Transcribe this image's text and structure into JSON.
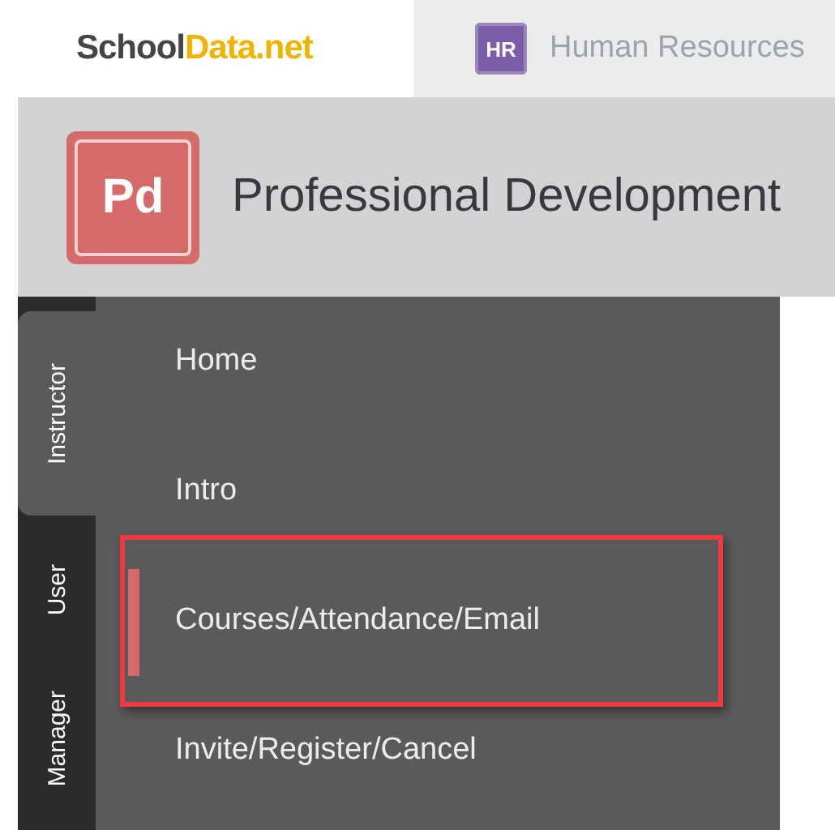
{
  "brand": {
    "first": "School",
    "second": "Data.net"
  },
  "app_tabs": [
    {
      "badge": "HR",
      "label": "Human Resources",
      "color": "#7b5ea7"
    }
  ],
  "header": {
    "logo": "Pd",
    "title": "Professional Development"
  },
  "side_tabs": [
    {
      "label": "Instructor",
      "selected": true
    },
    {
      "label": "User",
      "selected": false
    },
    {
      "label": "Manager",
      "selected": false
    }
  ],
  "menu": [
    {
      "label": "Home",
      "selected": false,
      "highlighted": false
    },
    {
      "label": "Intro",
      "selected": false,
      "highlighted": false
    },
    {
      "label": "Courses/Attendance/Email",
      "selected": true,
      "highlighted": true
    },
    {
      "label": "Invite/Register/Cancel",
      "selected": false,
      "highlighted": false
    }
  ]
}
